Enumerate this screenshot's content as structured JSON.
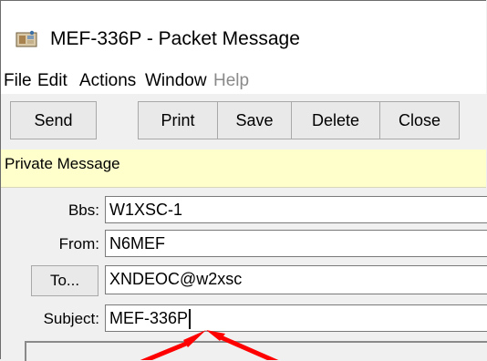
{
  "window": {
    "title": "MEF-336P - Packet Message",
    "icon": "packet-app-icon"
  },
  "menu": [
    {
      "label": "File",
      "enabled": true
    },
    {
      "label": "Edit",
      "enabled": true
    },
    {
      "label": "Actions",
      "enabled": true
    },
    {
      "label": "Window",
      "enabled": true
    },
    {
      "label": "Help",
      "enabled": false
    }
  ],
  "toolbar": {
    "send": "Send",
    "print": "Print",
    "save": "Save",
    "delete": "Delete",
    "close": "Close"
  },
  "notice": {
    "text": "Private Message",
    "color": "#ffffcc"
  },
  "form": {
    "bbs_label": "Bbs:",
    "bbs_value": "W1XSC-1",
    "from_label": "From:",
    "from_value": "N6MEF",
    "to_button": "To...",
    "to_value": "XNDEOC@w2xsc",
    "subject_label": "Subject:",
    "subject_value": "MEF-336P"
  },
  "annotation": {
    "arrow_color": "#ff0000",
    "points_to": "subject-field"
  }
}
